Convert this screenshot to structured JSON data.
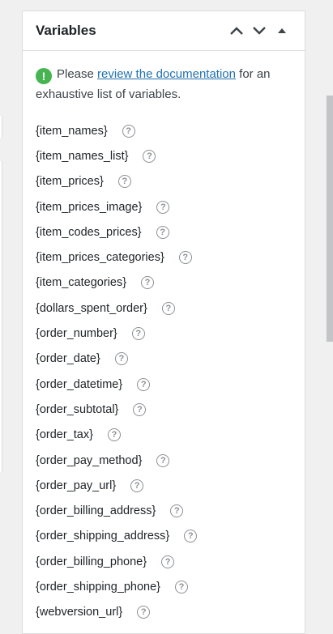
{
  "panel": {
    "title": "Variables",
    "icons": {
      "move_up": "chevron-up-icon",
      "move_down": "chevron-down-icon",
      "toggle": "caret-up-icon"
    }
  },
  "notice": {
    "icon": "!",
    "prefix": "Please ",
    "link_text": "review the documentation",
    "suffix": " for an exhaustive list of variables."
  },
  "help_icon": "?",
  "variables": [
    "{item_names}",
    "{item_names_list}",
    "{item_prices}",
    "{item_prices_image}",
    "{item_codes_prices}",
    "{item_prices_categories}",
    "{item_categories}",
    "{dollars_spent_order}",
    "{order_number}",
    "{order_date}",
    "{order_datetime}",
    "{order_subtotal}",
    "{order_tax}",
    "{order_pay_method}",
    "{order_pay_url}",
    "{order_billing_address}",
    "{order_shipping_address}",
    "{order_billing_phone}",
    "{order_shipping_phone}",
    "{webversion_url}"
  ],
  "colors": {
    "notice_icon": "#46b450",
    "link": "#2271b1",
    "background": "#f0f0f1"
  }
}
